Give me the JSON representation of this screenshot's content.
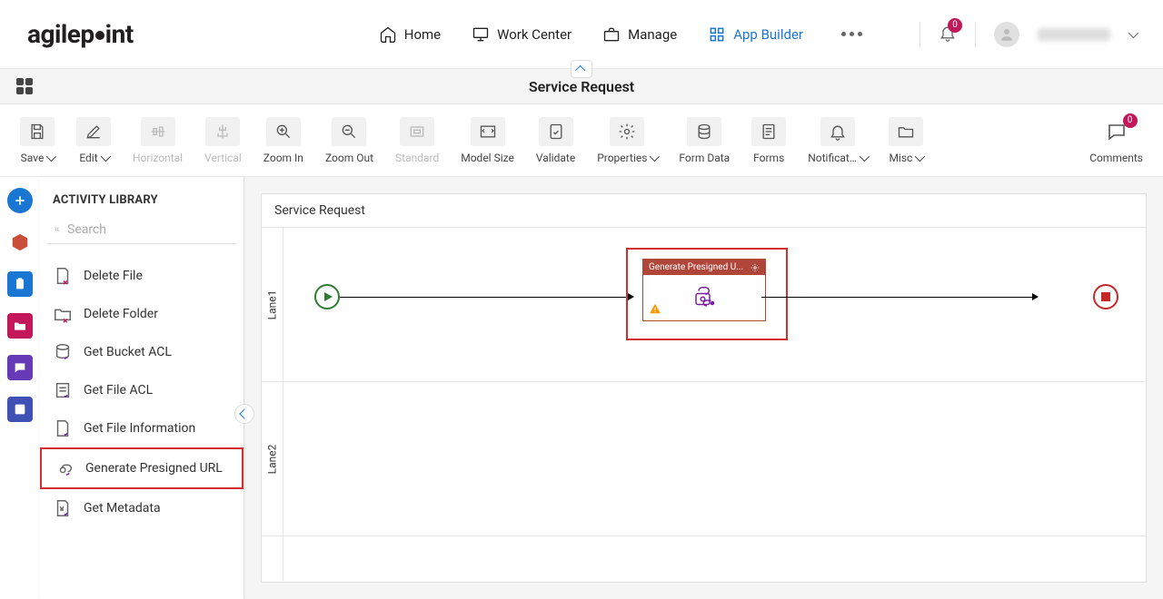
{
  "header": {
    "logo": "agilepoint",
    "nav": [
      {
        "label": "Home",
        "icon": "home-icon"
      },
      {
        "label": "Work Center",
        "icon": "monitor-icon"
      },
      {
        "label": "Manage",
        "icon": "briefcase-icon"
      },
      {
        "label": "App Builder",
        "icon": "grid-icon",
        "active": true
      }
    ],
    "notification_count": "0"
  },
  "subheader": {
    "title": "Service Request"
  },
  "toolbar": [
    {
      "label": "Save",
      "chevron": true
    },
    {
      "label": "Edit",
      "chevron": true
    },
    {
      "label": "Horizontal",
      "disabled": true
    },
    {
      "label": "Vertical",
      "disabled": true
    },
    {
      "label": "Zoom In"
    },
    {
      "label": "Zoom Out"
    },
    {
      "label": "Standard",
      "disabled": true
    },
    {
      "label": "Model Size"
    },
    {
      "label": "Validate"
    },
    {
      "label": "Properties",
      "chevron": true
    },
    {
      "label": "Form Data"
    },
    {
      "label": "Forms"
    },
    {
      "label": "Notificat…",
      "chevron": true
    },
    {
      "label": "Misc",
      "chevron": true
    }
  ],
  "comments": {
    "label": "Comments",
    "count": "0"
  },
  "panel": {
    "title": "ACTIVITY LIBRARY",
    "search_placeholder": "Search",
    "items": [
      {
        "label": "Delete File"
      },
      {
        "label": "Delete Folder"
      },
      {
        "label": "Get Bucket ACL"
      },
      {
        "label": "Get File ACL"
      },
      {
        "label": "Get File Information"
      },
      {
        "label": "Generate Presigned URL",
        "highlight": true
      },
      {
        "label": "Get Metadata"
      }
    ]
  },
  "canvas": {
    "title": "Service Request",
    "lanes": [
      "Lane1",
      "Lane2"
    ],
    "activity_node": {
      "title": "Generate Presigned U..."
    }
  }
}
